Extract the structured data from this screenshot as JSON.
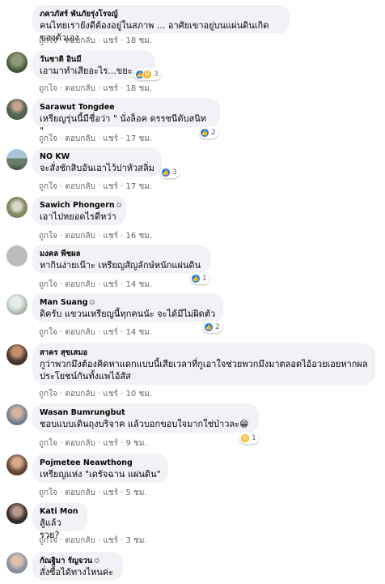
{
  "actions": {
    "like": "ถูกใจ",
    "reply": "ตอบกลับ",
    "share": "แชร์",
    "sep": "·"
  },
  "colors": {
    "bubble": "#f0f2f5",
    "name": "#050505",
    "meta": "#65676b",
    "like_blue": "#1877f2",
    "haha_yellow": "#f7b125"
  },
  "comments": [
    {
      "name": "ภควภัสร์ พันภัยรุ่งโรจญ์",
      "badge": "",
      "text": "คนไทยเรายังดีต้องอยู่ในสภาพ ... อาศัยเขาอยู่บนแผ่นดินเกิดของตัวเอง",
      "time": "18 ชม.",
      "reactions": null
    },
    {
      "name": "วันชาติ อินมี",
      "badge": "",
      "text": "เอามาทำเสียอะไร...ขยะ",
      "time": "18 ชม.",
      "reactions": {
        "icons": [
          "like-icon",
          "haha-icon"
        ],
        "count": "3"
      }
    },
    {
      "name": "Sarawut Tongdee",
      "badge": "",
      "text": "เหรียญรุ่นนี้มีชื่อว่า \" นั่งล็อค ดรรชนีดับสนิท \"",
      "time": "17 ชม.",
      "reactions": {
        "icons": [
          "like-icon"
        ],
        "count": "2"
      }
    },
    {
      "name": "NO KW",
      "badge": "",
      "text": "จะสั่งชักสิบอันเอาไว้ปาหัวสลิ่ม",
      "time": "17 ชม.",
      "reactions": {
        "icons": [
          "like-icon"
        ],
        "count": "3"
      }
    },
    {
      "name": "Sawich Phongern",
      "badge": "✪",
      "text": "เอาไปหยอดไรดีหว่า",
      "time": "16 ชม.",
      "reactions": null
    },
    {
      "name": "มงคล พีชผล",
      "badge": "",
      "text": "หากินง่ายเน๊าะ เหรียญสัญลักษ์หนักแผ่นดิน",
      "time": "14 ชม.",
      "reactions": {
        "icons": [
          "like-icon"
        ],
        "count": "1"
      }
    },
    {
      "name": "Man Suang",
      "badge": "✪",
      "text": "ดิครับ แขวนเหรียญนี้ทุกคนนัะ จะได้มีไม่ผิดตัว",
      "time": "14 ชม.",
      "reactions": {
        "icons": [
          "like-icon"
        ],
        "count": "2"
      }
    },
    {
      "name": "สาคร สุขเสมอ",
      "badge": "",
      "text": "กูว่าพวกมึงต้องคิดหาแดกแบบนี้เสียเวลาที่กูเอาใจช่วยพวกมึงมาตลอดไอ้อวยเอยหากผลประโยชน์กันทั้งแพไอ้สัส",
      "time": "10 ชม.",
      "reactions": null
    },
    {
      "name": "Wasan Bumrungbut",
      "badge": "",
      "text": "ชอบแบบเดินถุงบริจาค แล้วบอกขอบใจมากใช่ป่าวละ😁",
      "time": "9 ชม.",
      "reactions": {
        "icons": [
          "haha-icon"
        ],
        "count": "1"
      }
    },
    {
      "name": "Pojmetee Neawthong",
      "badge": "",
      "text": "เหรียญแห่ง \"เดรัจฉาน แผ่นดิน\"",
      "time": "5 ชม.",
      "reactions": null
    },
    {
      "name": "Kati Mon",
      "badge": "",
      "text": "สู้แล้วรวย?",
      "time": "3 ชม.",
      "reactions": null
    },
    {
      "name": "กัณฐิมา รัญจวน",
      "badge": "✪",
      "text": "สั่งซื้อได้ทางไหนค่ะ",
      "time": "",
      "reactions": null
    }
  ]
}
